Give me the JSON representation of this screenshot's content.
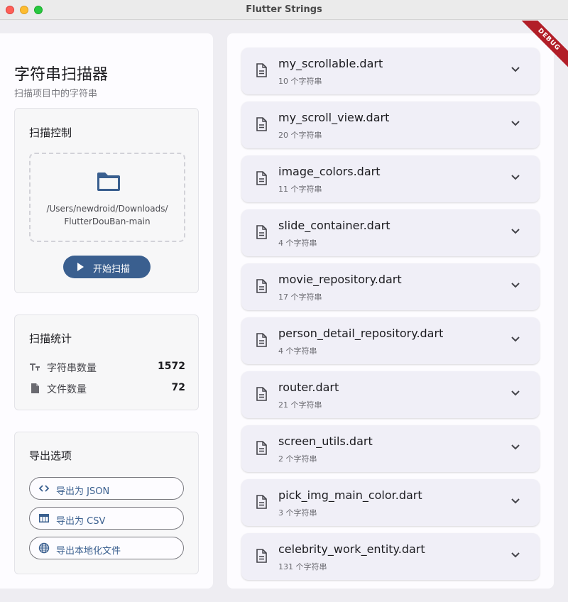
{
  "window": {
    "title": "Flutter Strings"
  },
  "sidebar": {
    "title": "字符串扫描器",
    "subtitle": "扫描项目中的字符串",
    "scan_control": {
      "title": "扫描控制",
      "path_line1": "/Users/newdroid/Downloads/",
      "path_line2": "FlutterDouBan-main",
      "scan_button": "开始扫描"
    },
    "stats": {
      "title": "扫描统计",
      "strings_label": "字符串数量",
      "strings_value": "1572",
      "files_label": "文件数量",
      "files_value": "72"
    },
    "export": {
      "title": "导出选项",
      "json_label": "导出为 JSON",
      "csv_label": "导出为 CSV",
      "l10n_label": "导出本地化文件"
    }
  },
  "files": [
    {
      "name": "my_scrollable.dart",
      "count": "10 个字符串"
    },
    {
      "name": "my_scroll_view.dart",
      "count": "20 个字符串"
    },
    {
      "name": "image_colors.dart",
      "count": "11 个字符串"
    },
    {
      "name": "slide_container.dart",
      "count": "4 个字符串"
    },
    {
      "name": "movie_repository.dart",
      "count": "17 个字符串"
    },
    {
      "name": "person_detail_repository.dart",
      "count": "4 个字符串"
    },
    {
      "name": "router.dart",
      "count": "21 个字符串"
    },
    {
      "name": "screen_utils.dart",
      "count": "2 个字符串"
    },
    {
      "name": "pick_img_main_color.dart",
      "count": "3 个字符串"
    },
    {
      "name": "celebrity_work_entity.dart",
      "count": "131 个字符串"
    }
  ],
  "debug_banner": "DEBUG",
  "colors": {
    "accent": "#3a5f8f",
    "debug": "#b21e28"
  }
}
